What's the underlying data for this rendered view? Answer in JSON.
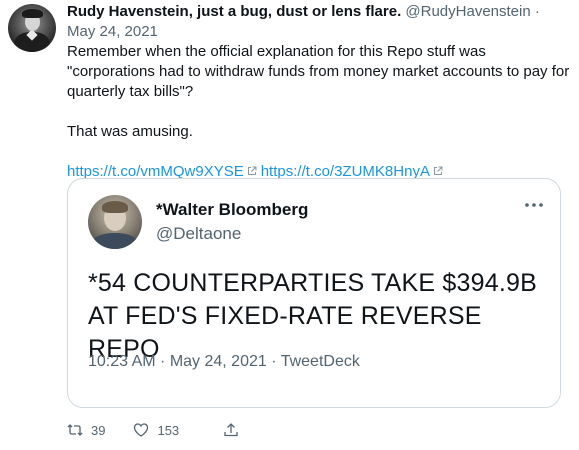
{
  "tweet": {
    "author_name": "Rudy Havenstein, just a bug, dust or lens flare.",
    "author_handle": "@RudyHavenstein",
    "separator": "·",
    "date": "May 24, 2021",
    "text_line1": "Remember when the official explanation for this Repo stuff was \"corporations had to withdraw funds from money market accounts to pay for quarterly tax bills\"?",
    "text_line2": "That was amusing.",
    "link1": "https://t.co/vmMQw9XYSE",
    "link2": "https://t.co/3ZUMK8HnyA",
    "link_color": "#1b95e0"
  },
  "quoted_tweet": {
    "author_name": "*Walter Bloomberg",
    "author_handle": "@Deltaone",
    "more_icon": "more-icon",
    "text": "*54 COUNTERPARTIES TAKE $394.9B AT FED'S FIXED-RATE REVERSE REPO",
    "meta": "10:23 AM · May 24, 2021 · TweetDeck"
  },
  "actions": {
    "retweet_icon": "retweet-icon",
    "retweet_count": "39",
    "like_icon": "heart-icon",
    "like_count": "153",
    "share_icon": "share-icon"
  }
}
